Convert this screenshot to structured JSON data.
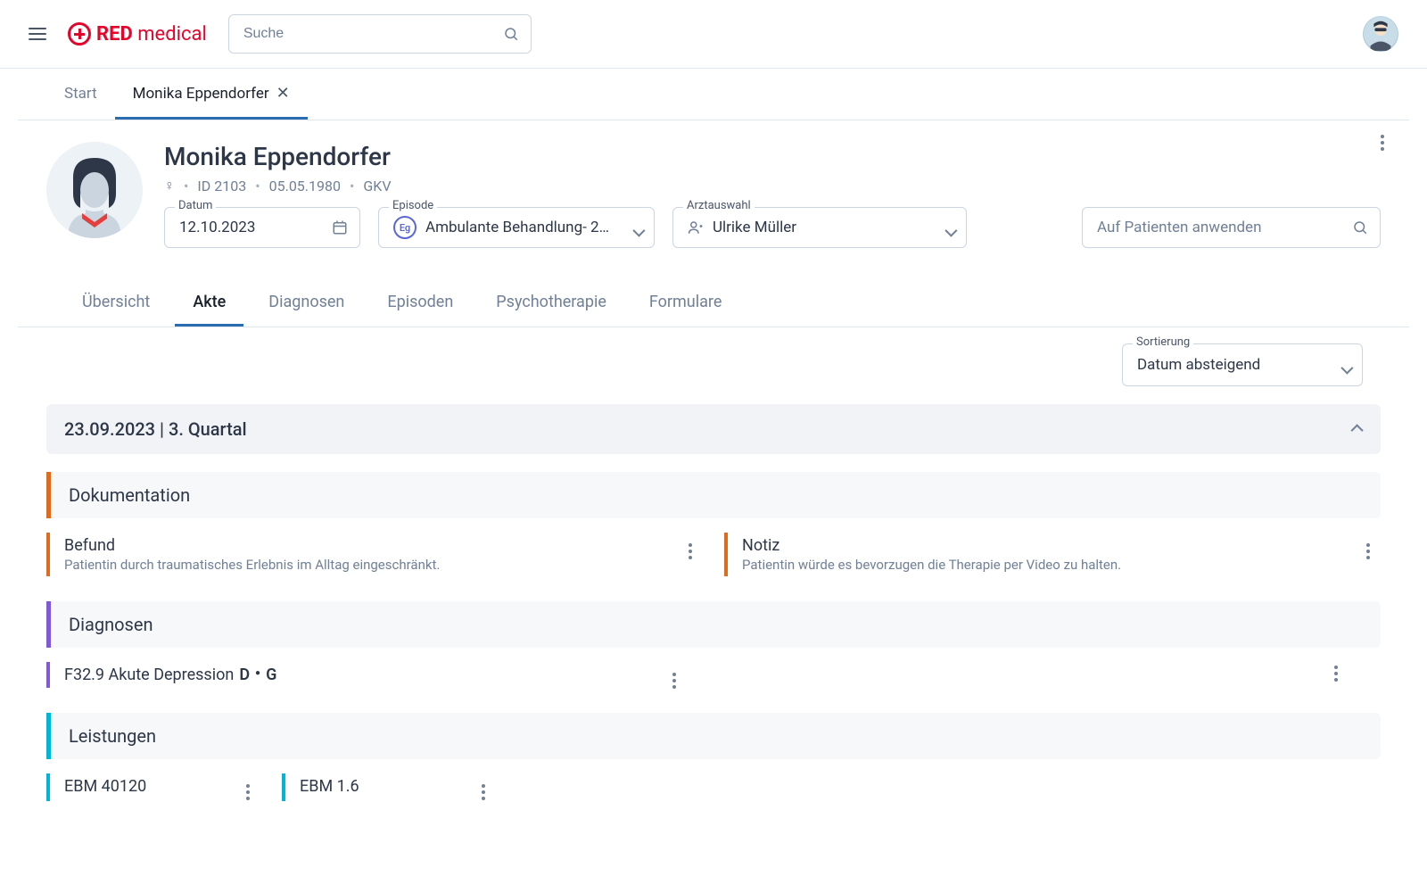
{
  "header": {
    "logo_red": "RED",
    "logo_medical": "medical",
    "search_placeholder": "Suche"
  },
  "nav_tabs": {
    "start": "Start",
    "patient": "Monika Eppendorfer"
  },
  "patient": {
    "name": "Monika Eppendorfer",
    "gender_symbol": "♀",
    "id_label": "ID 2103",
    "birthdate": "05.05.1980",
    "insurance": "GKV"
  },
  "fields": {
    "date_label": "Datum",
    "date_value": "12.10.2023",
    "episode_label": "Episode",
    "episode_badge": "Eg",
    "episode_value": "Ambulante Behandlung- 2…",
    "doctor_label": "Arztauswahl",
    "doctor_value": "Ulrike Müller",
    "patient_search_placeholder": "Auf Patienten anwenden"
  },
  "sub_tabs": {
    "overview": "Übersicht",
    "akte": "Akte",
    "diagnosen": "Diagnosen",
    "episoden": "Episoden",
    "psychotherapie": "Psychotherapie",
    "formulare": "Formulare"
  },
  "sort": {
    "label": "Sortierung",
    "value": "Datum absteigend"
  },
  "date_group": {
    "title": "23.09.2023 | 3. Quartal"
  },
  "sections": {
    "dokumentation": {
      "title": "Dokumentation",
      "cards": [
        {
          "title": "Befund",
          "text": "Patientin durch traumatisches Erlebnis im Alltag eingeschränkt."
        },
        {
          "title": "Notiz",
          "text": "Patientin würde es bevorzugen die Therapie per Video zu halten."
        }
      ]
    },
    "diagnosen": {
      "title": "Diagnosen",
      "items": [
        {
          "code": "F32.9 Akute Depression",
          "suffix1": "D",
          "suffix2": "G"
        }
      ]
    },
    "leistungen": {
      "title": "Leistungen",
      "items": [
        {
          "label": "EBM 40120"
        },
        {
          "label": "EBM 1.6"
        }
      ]
    }
  }
}
